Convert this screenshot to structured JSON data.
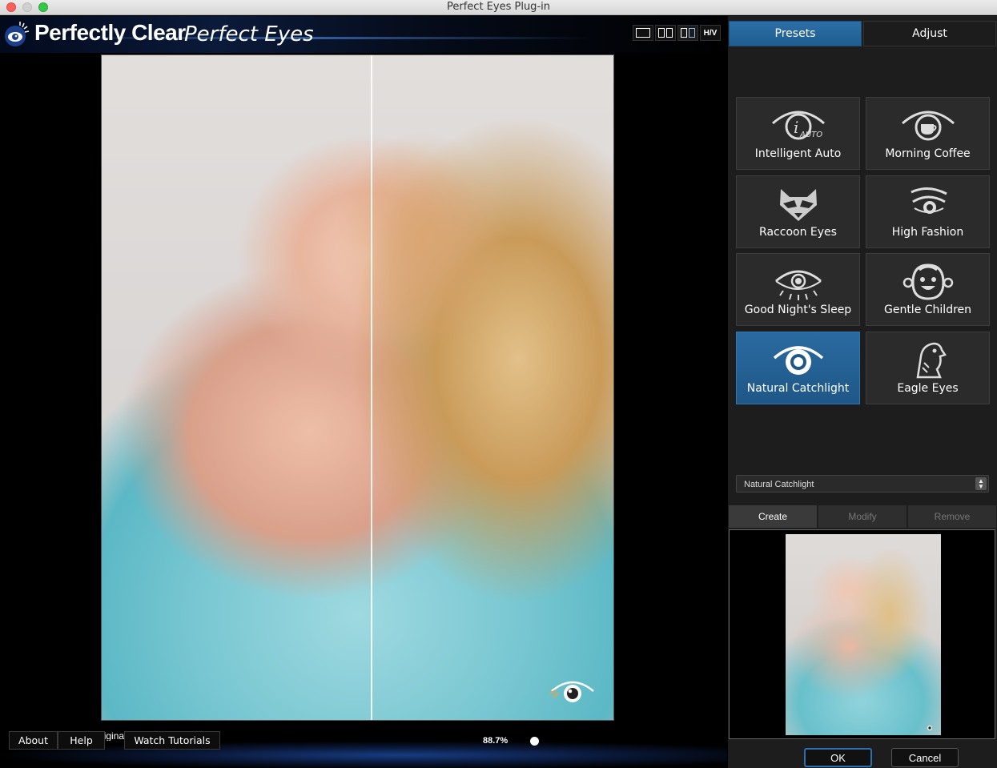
{
  "window": {
    "title": "Perfect Eyes Plug-in"
  },
  "brand": {
    "name": "Perfectly Clear",
    "product": "Perfect Eyes"
  },
  "view_modes": {
    "hv_label": "H/V"
  },
  "preview": {
    "hint": "Click on preview for original",
    "zoom": "88.7%"
  },
  "footer": {
    "about": "About",
    "help": "Help",
    "tutorials": "Watch Tutorials"
  },
  "tabs": {
    "presets": "Presets",
    "adjust": "Adjust"
  },
  "presets": [
    {
      "label": "Intelligent Auto",
      "icon": "intelligent-auto-icon"
    },
    {
      "label": "Morning Coffee",
      "icon": "coffee-eye-icon"
    },
    {
      "label": "Raccoon Eyes",
      "icon": "raccoon-icon"
    },
    {
      "label": "High Fashion",
      "icon": "fashion-eye-icon"
    },
    {
      "label": "Good Night's Sleep",
      "icon": "sleep-eye-icon"
    },
    {
      "label": "Gentle Children",
      "icon": "child-face-icon"
    },
    {
      "label": "Natural Catchlight",
      "icon": "catchlight-eye-icon",
      "selected": true
    },
    {
      "label": "Eagle Eyes",
      "icon": "eagle-icon"
    }
  ],
  "auto_badge": "AUTO",
  "preset_select": {
    "value": "Natural Catchlight"
  },
  "preset_actions": {
    "create": "Create",
    "modify": "Modify",
    "remove": "Remove"
  },
  "dialog": {
    "ok": "OK",
    "cancel": "Cancel"
  },
  "colors": {
    "accent": "#2a6aa0",
    "panel": "#1d1d1d",
    "tile": "#2b2b2b"
  }
}
